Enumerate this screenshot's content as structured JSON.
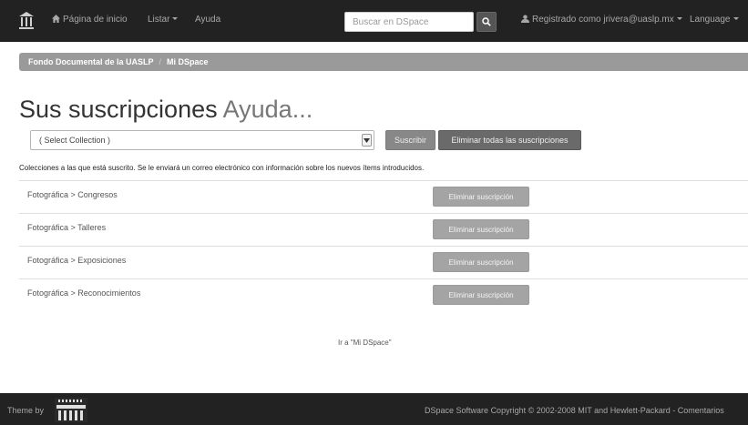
{
  "navbar": {
    "home_label": "Página de inicio",
    "listar_label": "Listar",
    "ayuda_label": "Ayuda",
    "search_placeholder": "Buscar en DSpace",
    "user_label": "Registrado como jrivera@uaslp.mx",
    "language_label": "Language"
  },
  "breadcrumb": {
    "items": [
      "Fondo Documental de la UASLP",
      "Mi DSpace"
    ],
    "separator": "/"
  },
  "title": {
    "main": "Sus suscripciones",
    "help": "Ayuda..."
  },
  "subscribe_form": {
    "selected_collection": "( Select Collection )",
    "subscribe_label": "Suscribir",
    "remove_all_label": "Eliminar todas las suscripciones"
  },
  "info_text": "Colecciones a las que está suscrito. Se le enviará un correo electrónico con información sobre los nuevos ítems introducidos.",
  "subscriptions": [
    {
      "label": "Fotográfica > Congresos",
      "remove_label": "Eliminar suscripción"
    },
    {
      "label": "Fotográfica > Talleres",
      "remove_label": "Eliminar suscripción"
    },
    {
      "label": "Fotográfica > Exposiciones",
      "remove_label": "Eliminar suscripción"
    },
    {
      "label": "Fotográfica > Reconocimientos",
      "remove_label": "Eliminar suscripción"
    }
  ],
  "mydspace_link": "Ir a \"Mi DSpace\"",
  "footer": {
    "theme_by": "Theme by",
    "copyright_prefix": "DSpace Software",
    "copyright_text": "Copyright © 2002-2008",
    "mit": "MIT",
    "and": "and",
    "hp": "Hewlett-Packard",
    "dash": "-",
    "comments": "Comentarios"
  },
  "colors": {
    "navbar_bg": "#222222",
    "breadcrumb_bg": "#9a9a9a",
    "button_dark": "#6a6a6a",
    "button_light": "#a4a4a4"
  },
  "icons": {
    "logo": "uaslp-logo",
    "home": "home-icon",
    "search": "search-icon",
    "user": "user-icon",
    "select": "chevron-down-icon",
    "footer_logo": "cineca-logo"
  }
}
